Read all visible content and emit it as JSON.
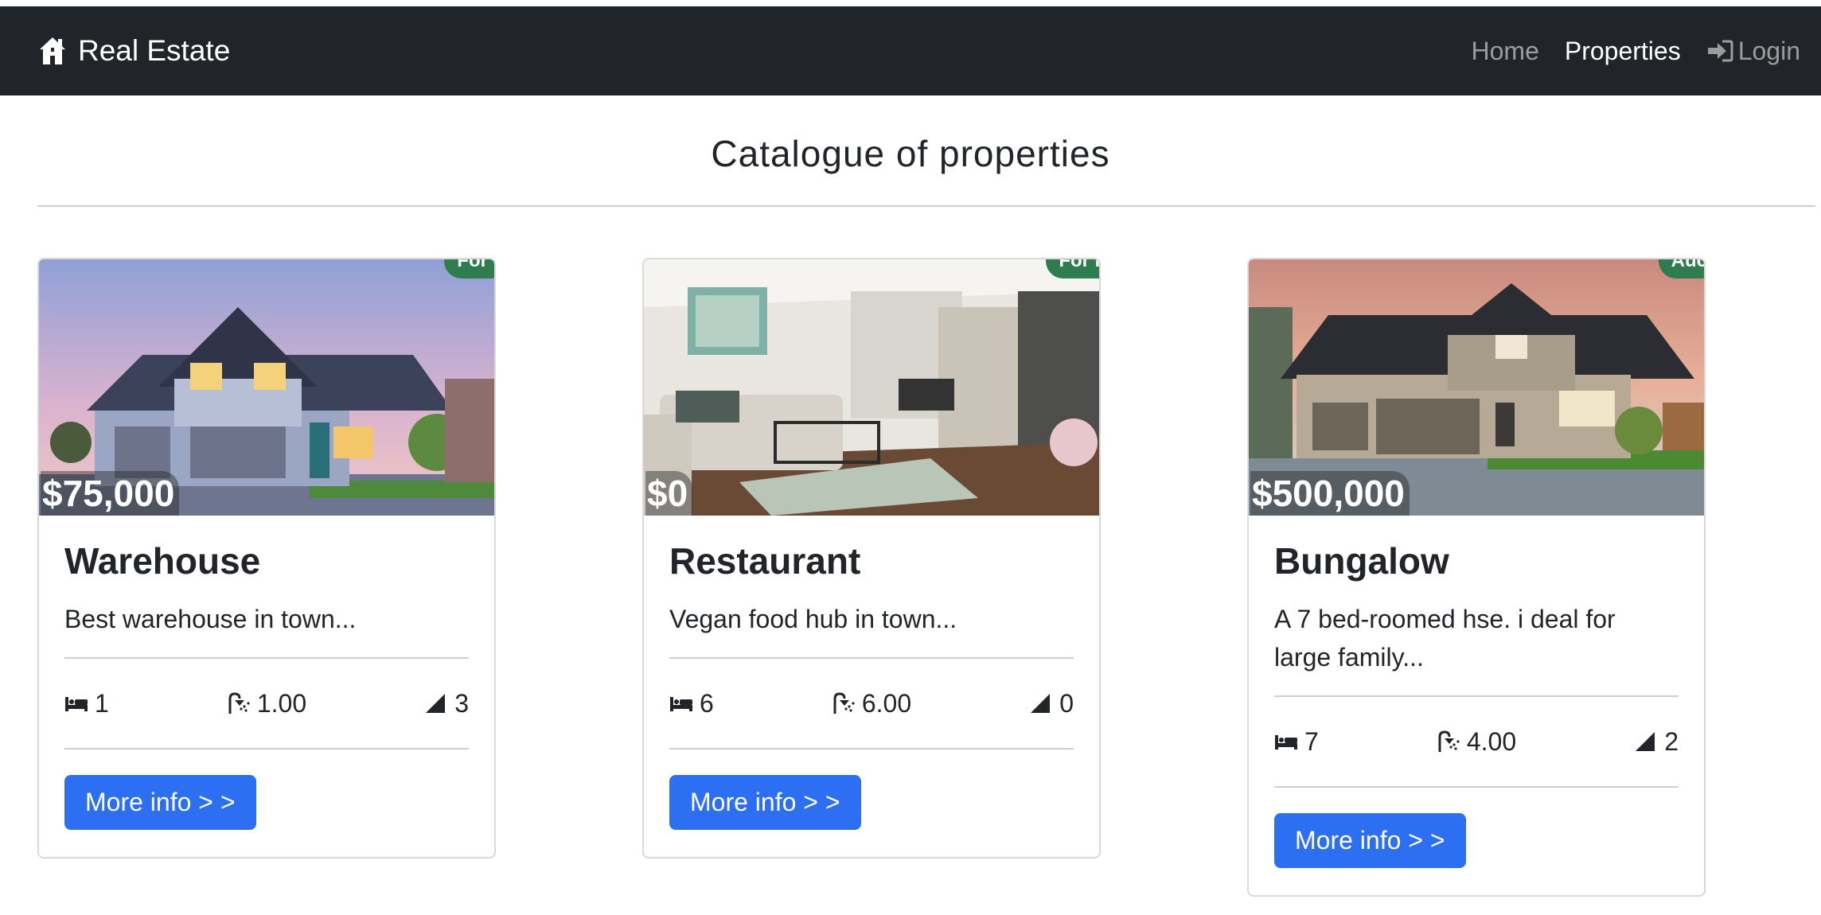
{
  "navbar": {
    "brand": "Real Estate",
    "links": [
      {
        "label": "Home"
      },
      {
        "label": "Properties"
      },
      {
        "label": "Login"
      }
    ]
  },
  "page": {
    "title": "Catalogue of properties"
  },
  "properties": [
    {
      "title": "Warehouse",
      "price": "$75,000",
      "status": "For Sale",
      "description": "Best warehouse in town...",
      "bedrooms": "1",
      "bathrooms": "1.00",
      "area": "3",
      "button": "More info > >"
    },
    {
      "title": "Restaurant",
      "price": "$0",
      "status": "For Rent",
      "description": "Vegan food hub in town...",
      "bedrooms": "6",
      "bathrooms": "6.00",
      "area": "0",
      "button": "More info > >"
    },
    {
      "title": "Bungalow",
      "price": "$500,000",
      "status": "Auction",
      "description": "A 7 bed-roomed hse. i deal for large family...",
      "bedrooms": "7",
      "bathrooms": "4.00",
      "area": "2",
      "button": "More info > >"
    }
  ],
  "colors": {
    "navbar_bg": "#212529",
    "badge_green": "#2f7d4f",
    "button_blue": "#2d6ff2"
  },
  "icons": {
    "brand": "house-icon",
    "login": "sign-in-icon",
    "bedrooms": "bed-icon",
    "bathrooms": "shower-icon",
    "area": "area-icon"
  }
}
